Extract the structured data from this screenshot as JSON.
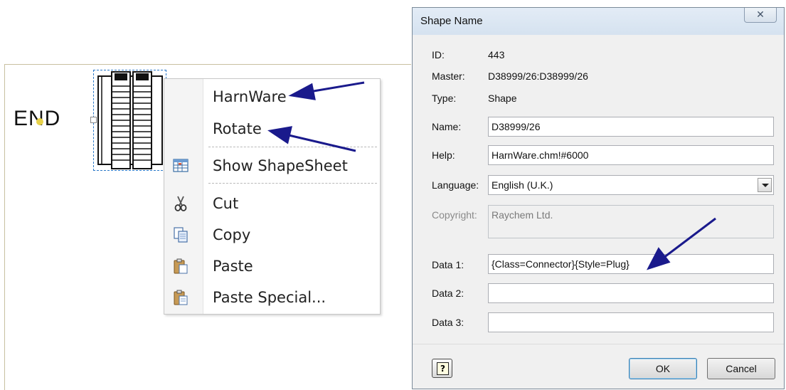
{
  "canvas": {
    "end_label": "END"
  },
  "context_menu": {
    "items": [
      {
        "label": "HarnWare",
        "icon": ""
      },
      {
        "label": "Rotate",
        "icon": ""
      },
      {
        "label": "Show ShapeSheet",
        "icon": "shapesheet-icon"
      },
      {
        "label": "Cut",
        "icon": "scissors-icon"
      },
      {
        "label": "Copy",
        "icon": "copy-icon"
      },
      {
        "label": "Paste",
        "icon": "paste-icon"
      },
      {
        "label": "Paste Special...",
        "icon": "paste-special-icon"
      }
    ]
  },
  "dialog": {
    "title": "Shape Name",
    "close_glyph": "✕",
    "id_label": "ID:",
    "id_value": "443",
    "master_label": "Master:",
    "master_value": "D38999/26:D38999/26",
    "type_label": "Type:",
    "type_value": "Shape",
    "name_label": "Name:",
    "name_value": "D38999/26",
    "help_label": "Help:",
    "help_value": "HarnWare.chm!#6000",
    "language_label": "Language:",
    "language_value": "English (U.K.)",
    "copyright_label": "Copyright:",
    "copyright_value": "Raychem Ltd.",
    "data1_label": "Data 1:",
    "data1_value": "{Class=Connector}{Style=Plug}",
    "data2_label": "Data 2:",
    "data2_value": "",
    "data3_label": "Data 3:",
    "data3_value": "",
    "help_button_glyph": "?",
    "ok_label": "OK",
    "cancel_label": "Cancel"
  },
  "colors": {
    "arrow": "#1a1a8c",
    "selection": "#2a78c8",
    "titlebar": "#d5e2f0"
  }
}
